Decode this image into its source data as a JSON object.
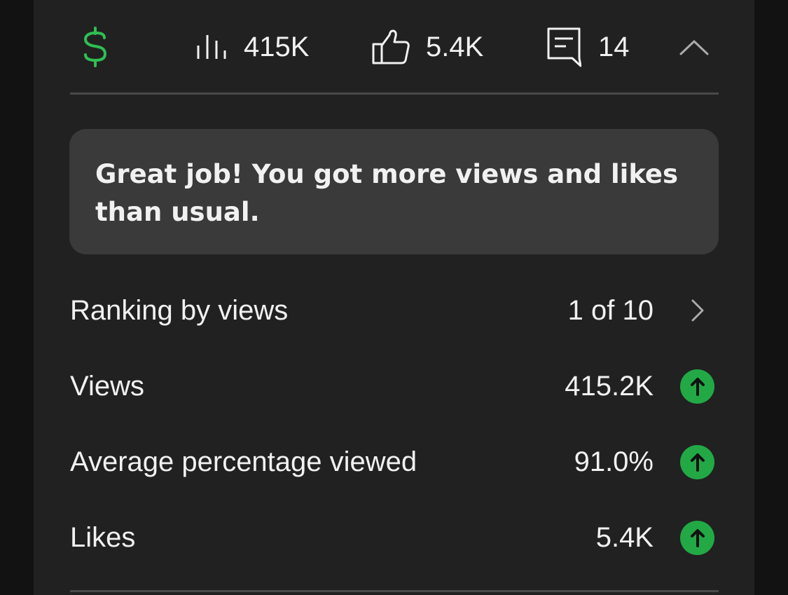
{
  "stats": {
    "revenue_icon": "dollar-icon",
    "views": "415K",
    "likes": "5.4K",
    "comments": "14",
    "collapse_icon": "chevron-up-icon"
  },
  "banner": {
    "message": "Great job! You got more views and likes than usual."
  },
  "metrics": [
    {
      "label": "Ranking by views",
      "value": "1 of 10",
      "icon": "chevron-right-icon"
    },
    {
      "label": "Views",
      "value": "415.2K",
      "icon": "arrow-up-icon"
    },
    {
      "label": "Average percentage viewed",
      "value": "91.0%",
      "icon": "arrow-up-icon"
    },
    {
      "label": "Likes",
      "value": "5.4K",
      "icon": "arrow-up-icon"
    }
  ],
  "colors": {
    "background": "#212121",
    "banner": "#3a3a3a",
    "positive": "#22a945",
    "revenue_icon": "#2fbf52"
  }
}
